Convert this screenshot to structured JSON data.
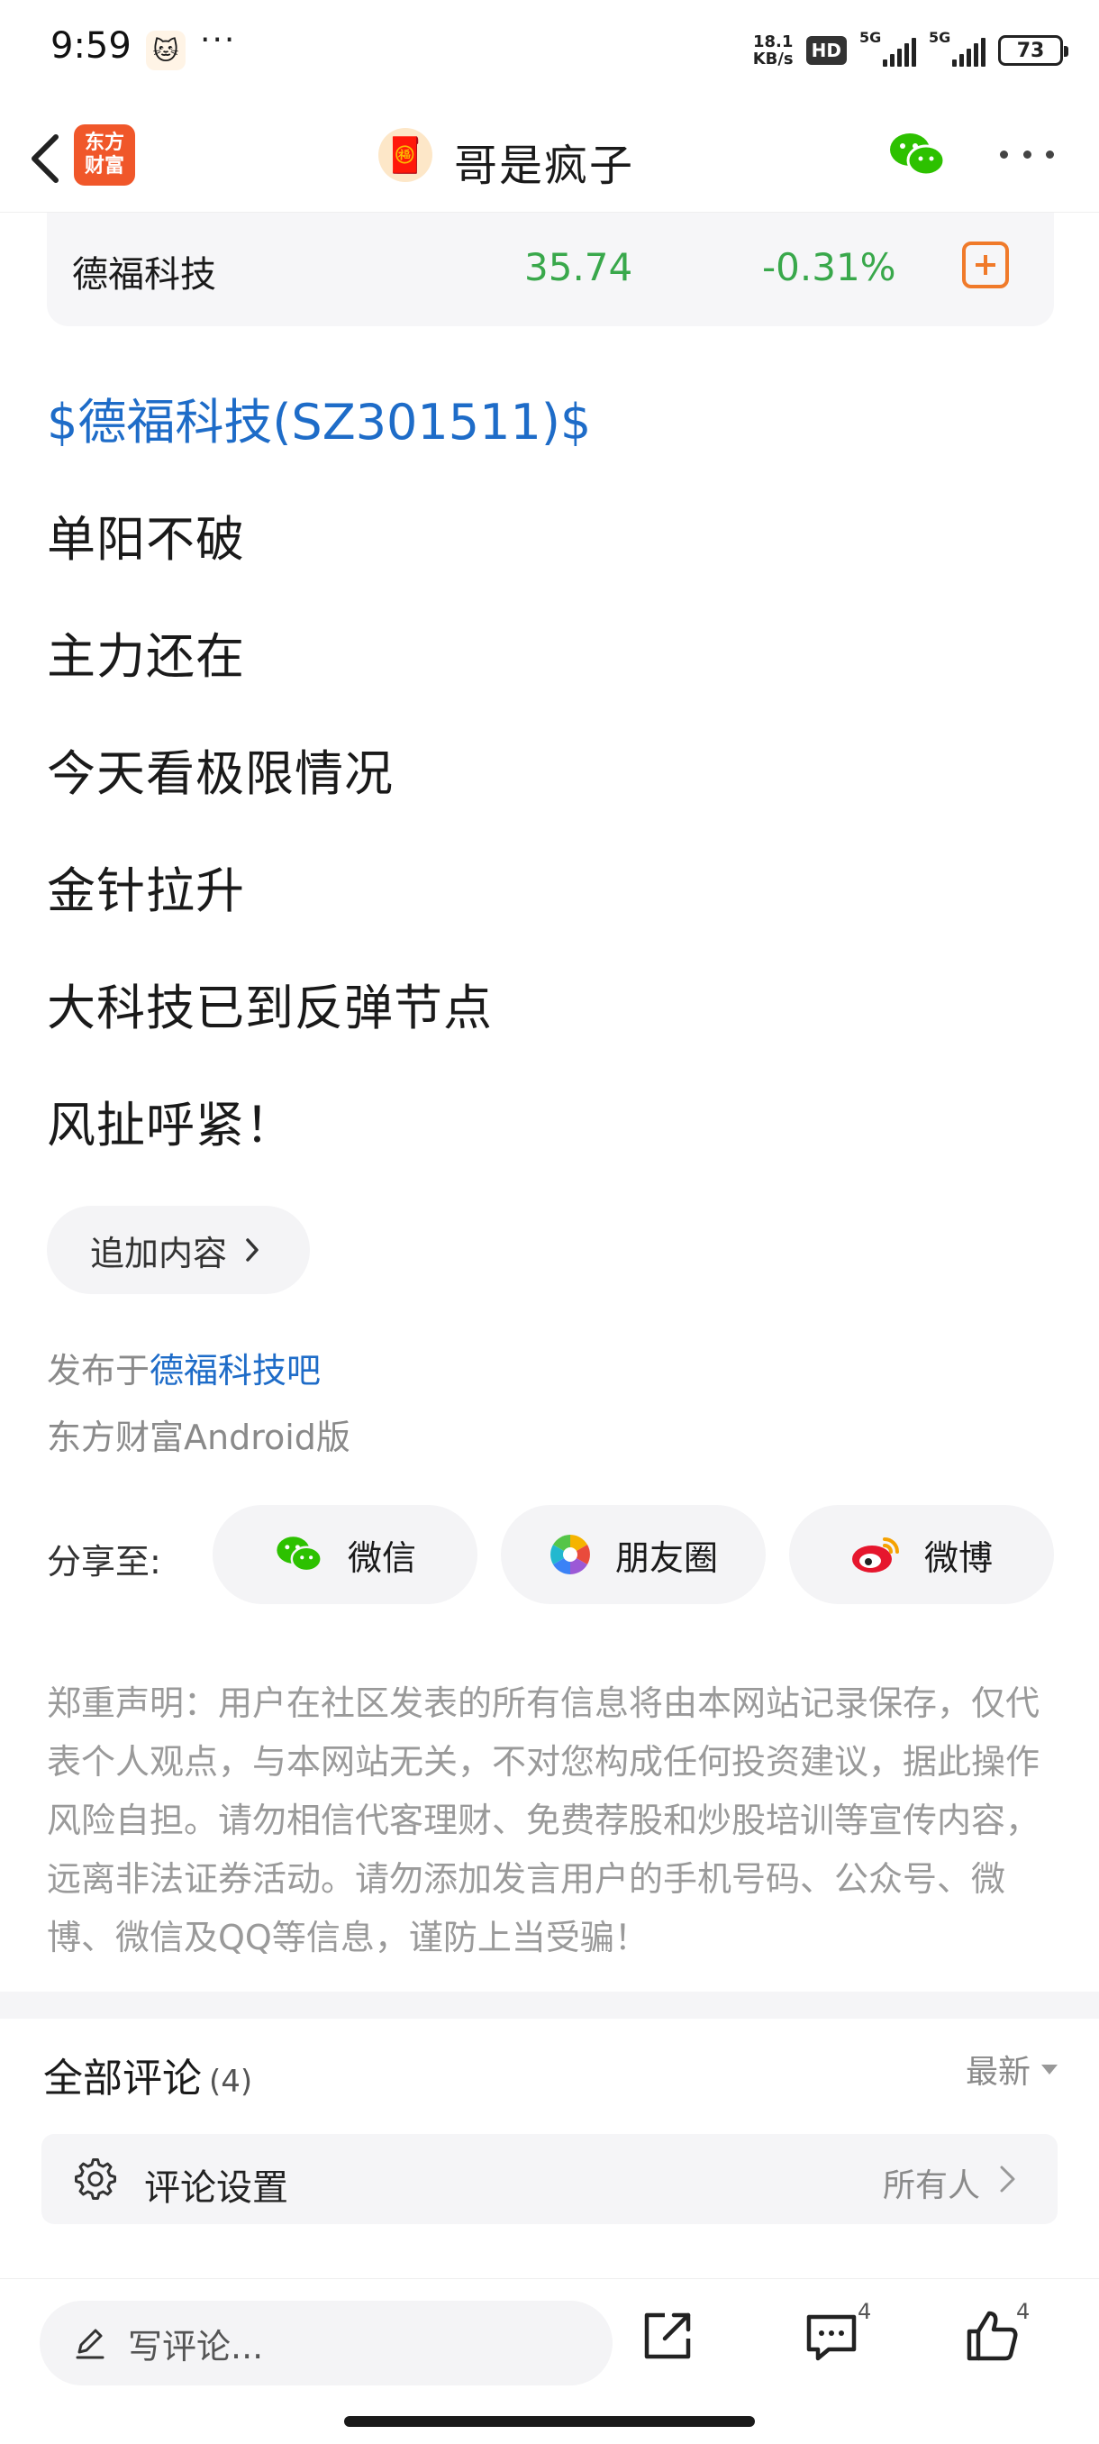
{
  "status_bar": {
    "time": "9:59",
    "dots": "···",
    "net_speed_value": "18.1",
    "net_speed_unit": "KB/s",
    "hd_badge": "HD",
    "sim1_label": "5G",
    "sim2_label": "5G",
    "battery": "73"
  },
  "header": {
    "app_logo_line1": "东方",
    "app_logo_line2": "财富",
    "author_name": "哥是疯子"
  },
  "stock_card": {
    "name": "德福科技",
    "price": "35.74",
    "change": "-0.31%",
    "change_color": "#39a84b"
  },
  "post": {
    "stock_link": "$德福科技(SZ301511)$",
    "lines": [
      "单阳不破",
      "主力还在",
      "今天看极限情况",
      "金针拉升",
      "大科技已到反弹节点",
      "风扯呼紧！"
    ],
    "append_label": "追加内容",
    "published_prefix": "发布于",
    "published_bar": "德福科技吧",
    "client": "东方财富Android版"
  },
  "share": {
    "label": "分享至:",
    "options": [
      {
        "label": "微信",
        "icon": "wechat-icon"
      },
      {
        "label": "朋友圈",
        "icon": "moments-icon"
      },
      {
        "label": "微博",
        "icon": "weibo-icon"
      }
    ]
  },
  "disclaimer": "郑重声明：用户在社区发表的所有信息将由本网站记录保存，仅代表个人观点，与本网站无关，不对您构成任何投资建议，据此操作风险自担。请勿相信代客理财、免费荐股和炒股培训等宣传内容，远离非法证券活动。请勿添加发言用户的手机号码、公众号、微博、微信及QQ等信息，谨防上当受骗！",
  "comments": {
    "title": "全部评论",
    "count": "(4)",
    "sort_label": "最新",
    "settings_label": "评论设置",
    "settings_value": "所有人"
  },
  "bottom_bar": {
    "write_placeholder": "写评论...",
    "comment_count": "4",
    "like_count": "4"
  },
  "colors": {
    "accent_blue": "#1e6cc8",
    "stock_down_green": "#39a84b",
    "brand_orange": "#f0572a"
  }
}
